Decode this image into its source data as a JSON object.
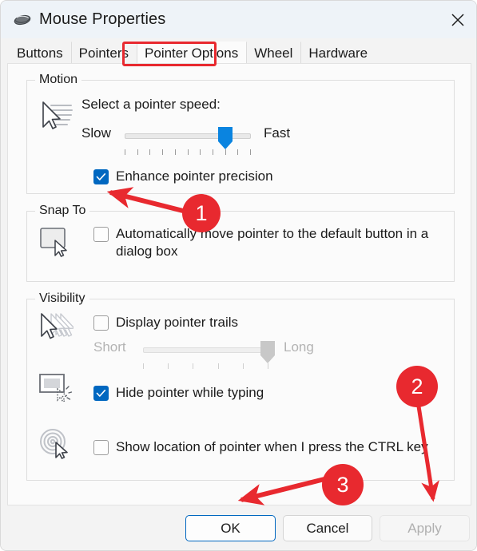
{
  "window": {
    "title": "Mouse Properties",
    "icon": "mouse-icon",
    "close_icon": "close-icon"
  },
  "tabs": [
    {
      "label": "Buttons",
      "active": false
    },
    {
      "label": "Pointers",
      "active": false
    },
    {
      "label": "Pointer Options",
      "active": true
    },
    {
      "label": "Wheel",
      "active": false
    },
    {
      "label": "Hardware",
      "active": false
    }
  ],
  "groups": {
    "motion": {
      "label": "Motion",
      "icon": "pointer-speed-icon",
      "speed_label": "Select a pointer speed:",
      "slider": {
        "min_label": "Slow",
        "max_label": "Fast",
        "ticks": 11,
        "value": 9,
        "enabled": true
      },
      "enhance_precision": {
        "label": "Enhance pointer precision",
        "checked": true
      }
    },
    "snapto": {
      "label": "Snap To",
      "icon": "default-button-icon",
      "auto_move": {
        "label": "Automatically move pointer to the default button in a dialog box",
        "checked": false
      }
    },
    "visibility": {
      "label": "Visibility",
      "trails": {
        "icon": "pointer-trails-icon",
        "label": "Display pointer trails",
        "checked": false
      },
      "trails_slider": {
        "min_label": "Short",
        "max_label": "Long",
        "ticks": 6,
        "value": 6,
        "enabled": false
      },
      "hide_typing": {
        "icon": "hide-pointer-typing-icon",
        "label": "Hide pointer while typing",
        "checked": true
      },
      "show_location": {
        "icon": "show-pointer-location-icon",
        "label": "Show location of pointer when I press the CTRL key",
        "checked": false
      }
    }
  },
  "buttons": {
    "ok": "OK",
    "cancel": "Cancel",
    "apply": "Apply"
  },
  "annotations": {
    "accent_color": "#e8292f",
    "highlight_tab": "Pointer Options",
    "badges": [
      {
        "number": "1",
        "points_to": "enhance-pointer-precision-checkbox"
      },
      {
        "number": "2",
        "points_to": "apply-button"
      },
      {
        "number": "3",
        "points_to": "ok-button"
      }
    ]
  }
}
